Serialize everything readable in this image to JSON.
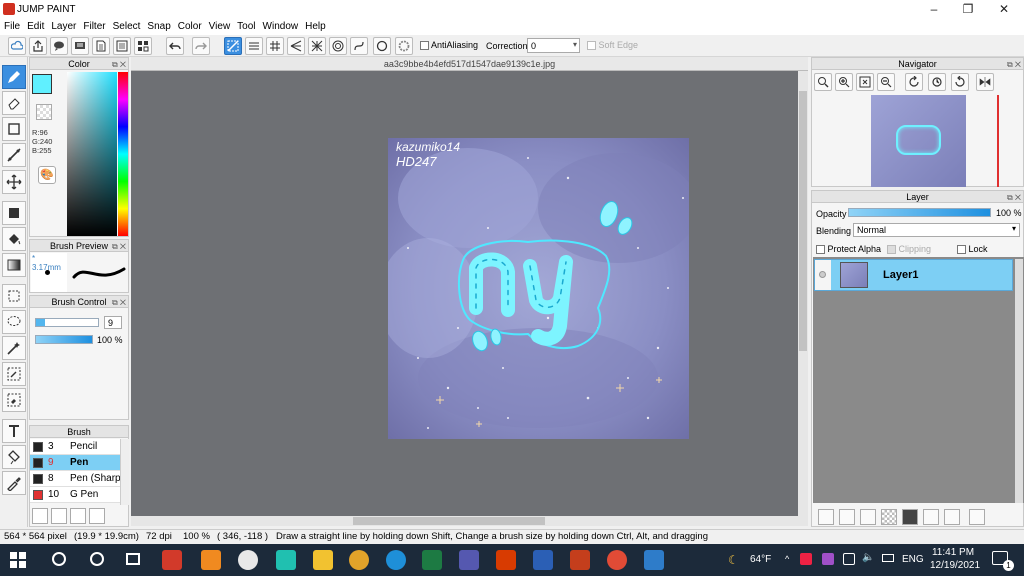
{
  "window": {
    "title": "JUMP PAINT",
    "minimize": "–",
    "restore": "❐",
    "close": "✕"
  },
  "menu": [
    "File",
    "Edit",
    "Layer",
    "Filter",
    "Select",
    "Snap",
    "Color",
    "View",
    "Tool",
    "Window",
    "Help"
  ],
  "toolbar": {
    "antialias_label": "AntiAliasing",
    "correction_label": "Correction",
    "correction_value": "0",
    "soft_edge_label": "Soft Edge"
  },
  "document": {
    "filename": "aa3c9bbe4b4efd517d1547dae9139c1e.jpg"
  },
  "artwork": {
    "signature_line1": "kazumiko14",
    "signature_line2": "HD247",
    "text": "ny"
  },
  "color_panel": {
    "title": "Color",
    "r": "R:96",
    "g": "G:240",
    "b": "B:255",
    "current": "#60f0ff"
  },
  "brush_preview": {
    "title": "Brush Preview",
    "size": "* 3.17mm"
  },
  "brush_control": {
    "title": "Brush Control",
    "size": "9",
    "opacity": "100 %"
  },
  "brush_panel": {
    "title": "Brush",
    "items": [
      {
        "size": "3",
        "name": "Pencil",
        "swatch": "#222222",
        "selected": false
      },
      {
        "size": "9",
        "name": "Pen",
        "swatch": "#222222",
        "selected": true
      },
      {
        "size": "8",
        "name": "Pen (Sharp)",
        "swatch": "#222222",
        "selected": false
      },
      {
        "size": "10",
        "name": "G Pen",
        "swatch": "#e03030",
        "selected": false
      }
    ]
  },
  "navigator": {
    "title": "Navigator"
  },
  "layer_panel": {
    "title": "Layer",
    "opacity_label": "Opacity",
    "opacity_value": "100 %",
    "blending_label": "Blending",
    "blending_value": "Normal",
    "protect_alpha": "Protect Alpha",
    "clipping": "Clipping",
    "lock": "Lock",
    "layers": [
      {
        "name": "Layer1"
      }
    ]
  },
  "status": {
    "size": "564 * 564 pixel",
    "cm": "(19.9 * 19.9cm)",
    "dpi": "72 dpi",
    "zoom": "100 %",
    "coords": "( 346, -118 )",
    "hint": "Draw a straight line by holding down Shift, Change a brush size by holding down Ctrl, Alt, and dragging"
  },
  "taskbar": {
    "weather": "64°F",
    "lang": "ENG",
    "time": "11:41 PM",
    "date": "12/19/2021",
    "notifications": "1"
  },
  "colors": {
    "accent": "#3b8fe0",
    "selection": "#7dcff4",
    "canvas_bg": "#6e7074",
    "taskbar": "#1c2a3a"
  }
}
